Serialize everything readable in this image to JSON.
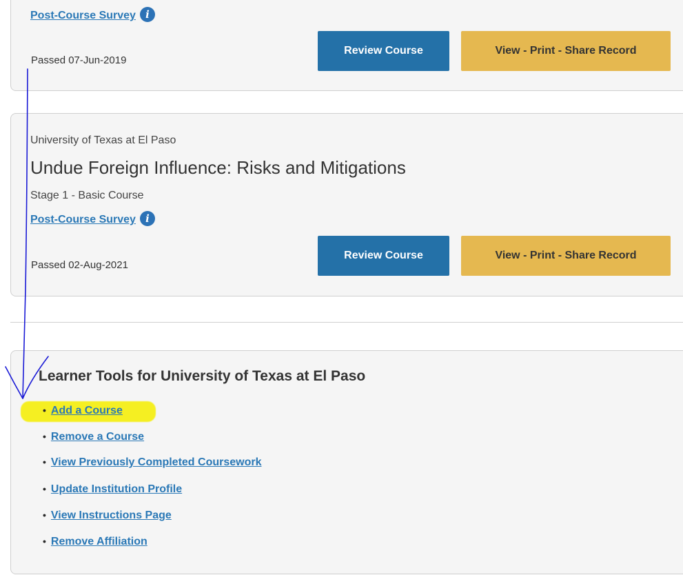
{
  "top_card": {
    "survey_link": "Post-Course Survey",
    "info_icon": "i",
    "passed": "Passed 07-Jun-2019",
    "review_button": "Review Course",
    "record_button": "View - Print - Share Record"
  },
  "course_card": {
    "institution": "University of Texas at El Paso",
    "title": "Undue Foreign Influence: Risks and Mitigations",
    "stage": "Stage 1 - Basic Course",
    "survey_link": "Post-Course Survey",
    "info_icon": "i",
    "passed": "Passed 02-Aug-2021",
    "review_button": "Review Course",
    "record_button": "View - Print - Share Record"
  },
  "learner_tools": {
    "heading": "Learner Tools for University of Texas at El Paso",
    "bullet": "•",
    "items": [
      {
        "label": "Add a Course"
      },
      {
        "label": "Remove a Course"
      },
      {
        "label": "View Previously Completed Coursework"
      },
      {
        "label": "Update Institution Profile"
      },
      {
        "label": "View Instructions Page"
      },
      {
        "label": "Remove Affiliation"
      }
    ]
  },
  "colors": {
    "link": "#2a78b6",
    "review_button": "#2471a8",
    "record_button": "#e5b850",
    "highlight": "#f5ef22",
    "annotation_pen": "#1a1ad6"
  }
}
